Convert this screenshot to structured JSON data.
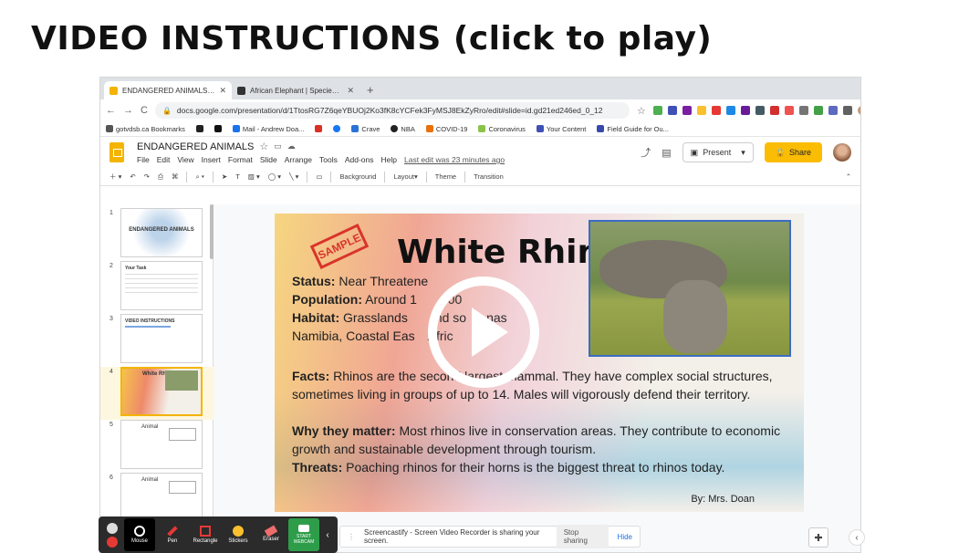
{
  "heading": "VIDEO INSTRUCTIONS (click to play)",
  "browser": {
    "tabs": [
      {
        "label": "ENDANGERED ANIMALS - Goo",
        "active": true,
        "favicon_color": "#f4b400"
      },
      {
        "label": "African Elephant | Species | W",
        "active": false,
        "favicon_color": "#333333"
      }
    ],
    "new_tab": "+",
    "url": "docs.google.com/presentation/d/1TtosRG7Z6qeYBUOj2Ko3fK8cYCFek3FyMSJ8EkZyRro/edit#slide=id.gd21ed246ed_0_12",
    "bookmarks": [
      {
        "label": "gotvdsb.ca Bookmarks",
        "color": "#555555"
      },
      {
        "label": "",
        "color": "#222222"
      },
      {
        "label": "",
        "color": "#111111"
      },
      {
        "label": "Mail - Andrew Doa...",
        "color": "#1a73e8"
      },
      {
        "label": "",
        "color": "#d93025"
      },
      {
        "label": "",
        "color": "#1877f2"
      },
      {
        "label": "Crave",
        "color": "#2a73d6"
      },
      {
        "label": "NBA",
        "color": "#222222"
      },
      {
        "label": "COVID-19",
        "color": "#e8710a"
      },
      {
        "label": "Coronavirus",
        "color": "#8bc34a"
      },
      {
        "label": "Your Content",
        "color": "#3f51b5"
      },
      {
        "label": "Field Guide for Ou...",
        "color": "#3949ab"
      }
    ]
  },
  "docs": {
    "title": "ENDANGERED ANIMALS",
    "menu": [
      "File",
      "Edit",
      "View",
      "Insert",
      "Format",
      "Slide",
      "Arrange",
      "Tools",
      "Add-ons",
      "Help"
    ],
    "last_edit": "Last edit was 23 minutes ago",
    "present": "Present",
    "share": "Share",
    "toolbar": [
      "Background",
      "Layout▾",
      "Theme",
      "Transition"
    ]
  },
  "filmstrip": [
    {
      "num": "1",
      "text": "ENDANGERED ANIMALS"
    },
    {
      "num": "2",
      "text": "Your Task"
    },
    {
      "num": "3",
      "text": "VIDEO INSTRUCTIONS"
    },
    {
      "num": "4",
      "text": "White Rhino"
    },
    {
      "num": "5",
      "text": "Animal"
    },
    {
      "num": "6",
      "text": "Animal"
    }
  ],
  "slide": {
    "stamp": "SAMPLE",
    "title": "White Rhino",
    "status_label": "Status:",
    "status": "Near Threatene",
    "population_label": "Population:",
    "population": "Around 1",
    "population_end": "000",
    "habitat_label": "Habitat:",
    "habitat": "Grasslands",
    "habitat_end": "nd so",
    "habitat_end2": "nas",
    "habitat_line2": "Namibia, Coastal Eas",
    "habitat_line2_end": "Afric",
    "facts_label": "Facts:",
    "facts": "Rhinos are the second largest mammal. They have complex social structures, sometimes living in groups of up to 14. Males will vigorously defend their territory.",
    "why_label": "Why they matter:",
    "why": "Most rhinos live in conservation areas. They contribute to economic growth and sustainable development through tourism.",
    "threats_label": "Threats:",
    "threats": "Poaching rhinos for their horns is the biggest threat to rhinos today.",
    "byline": "By: Mrs. Doan"
  },
  "screencastify": {
    "tools": [
      "Mouse",
      "Pen",
      "Rectangle",
      "Stickers",
      "Eraser",
      "START WEBCAM"
    ],
    "notice": "Screencastify - Screen Video Recorder is sharing your screen.",
    "stop": "Stop sharing",
    "hide": "Hide"
  }
}
